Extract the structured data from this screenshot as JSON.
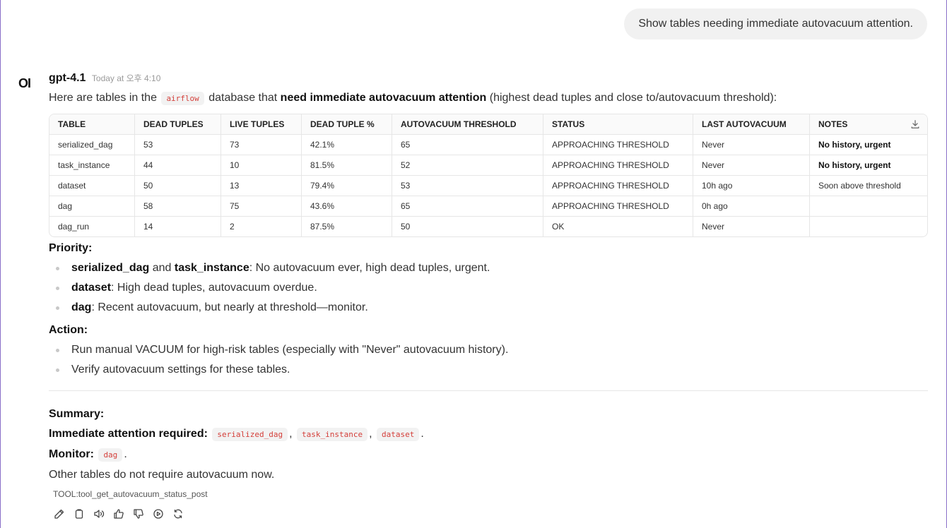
{
  "user_message": "Show tables needing immediate autovacuum attention.",
  "assistant": {
    "avatar_text": "OI",
    "model": "gpt-4.1",
    "timestamp": "Today at 오후 4:10"
  },
  "intro": {
    "part1": "Here are tables in the",
    "db_name": "airflow",
    "part2": "database that",
    "bold": "need immediate autovacuum attention",
    "part3": "(highest dead tuples and close to/autovacuum threshold):"
  },
  "table": {
    "headers": [
      "TABLE",
      "DEAD TUPLES",
      "LIVE TUPLES",
      "DEAD TUPLE %",
      "AUTOVACUUM THRESHOLD",
      "STATUS",
      "LAST AUTOVACUUM",
      "NOTES"
    ],
    "rows": [
      [
        "serialized_dag",
        "53",
        "73",
        "42.1%",
        "65",
        "APPROACHING THRESHOLD",
        "Never",
        "No history, urgent"
      ],
      [
        "task_instance",
        "44",
        "10",
        "81.5%",
        "52",
        "APPROACHING THRESHOLD",
        "Never",
        "No history, urgent"
      ],
      [
        "dataset",
        "50",
        "13",
        "79.4%",
        "53",
        "APPROACHING THRESHOLD",
        "10h ago",
        "Soon above threshold"
      ],
      [
        "dag",
        "58",
        "75",
        "43.6%",
        "65",
        "APPROACHING THRESHOLD",
        "0h ago",
        ""
      ],
      [
        "dag_run",
        "14",
        "2",
        "87.5%",
        "50",
        "OK",
        "Never",
        ""
      ]
    ]
  },
  "priority": {
    "title": "Priority:",
    "items": [
      {
        "bold1": "serialized_dag",
        "mid": "and",
        "bold2": "task_instance",
        "rest": ": No autovacuum ever, high dead tuples, urgent."
      },
      {
        "bold1": "dataset",
        "rest": ": High dead tuples, autovacuum overdue."
      },
      {
        "bold1": "dag",
        "rest": ": Recent autovacuum, but nearly at threshold—monitor."
      }
    ]
  },
  "action": {
    "title": "Action:",
    "items": [
      "Run manual VACUUM for high-risk tables (especially with \"Never\" autovacuum history).",
      "Verify autovacuum settings for these tables."
    ]
  },
  "summary": {
    "title": "Summary:",
    "immediate_label": "Immediate attention required:",
    "immediate_tables": [
      "serialized_dag",
      "task_instance",
      "dataset"
    ],
    "monitor_label": "Monitor:",
    "monitor_tables": [
      "dag"
    ],
    "other": "Other tables do not require autovacuum now."
  },
  "tool_call": "TOOL:tool_get_autovacuum_status_post",
  "action_icons": [
    "edit-icon",
    "copy-icon",
    "read-aloud-icon",
    "thumbs-up-icon",
    "thumbs-down-icon",
    "play-icon",
    "regenerate-icon"
  ]
}
